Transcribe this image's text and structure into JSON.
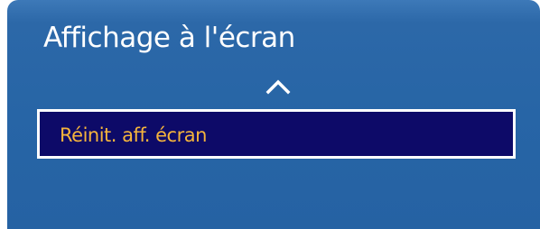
{
  "osd": {
    "title": "Affichage à l'écran",
    "scroll_up_icon": "chevron-up-icon",
    "menu_items": [
      {
        "label": "Réinit. aff. écran",
        "selected": true
      }
    ]
  },
  "colors": {
    "panel_blue": "#2765a6",
    "highlight_bg": "#0d0a68",
    "highlight_border": "#ffffff",
    "selected_text": "#f5b43c",
    "title_text": "#ffffff"
  }
}
